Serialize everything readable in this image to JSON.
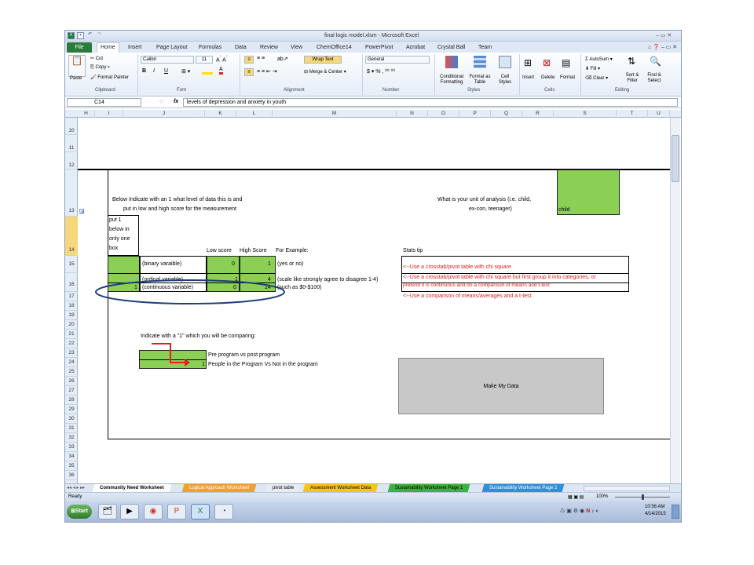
{
  "window": {
    "title": "final logic model.xlsm - Microsoft Excel"
  },
  "ribbon": {
    "file_tab": "File",
    "tabs": [
      "Home",
      "Insert",
      "Page Layout",
      "Formulas",
      "Data",
      "Review",
      "View",
      "ChemOffice14",
      "PowerPivot",
      "Acrobat",
      "Crystal Ball",
      "Team"
    ],
    "clipboard": {
      "paste": "Paste",
      "cut": "Cut",
      "copy": "Copy",
      "format_painter": "Format Painter",
      "label": "Clipboard"
    },
    "font": {
      "name": "Calibri",
      "size": "11",
      "label": "Font"
    },
    "alignment": {
      "wrap_text": "Wrap Text",
      "merge_center": "Merge & Center",
      "label": "Alignment"
    },
    "number": {
      "format": "General",
      "label": "Number"
    },
    "styles": {
      "conditional": "Conditional Formatting",
      "format_table": "Format as Table",
      "cell_styles": "Cell Styles",
      "label": "Styles"
    },
    "cells": {
      "insert": "Insert",
      "delete": "Delete",
      "format": "Format",
      "label": "Cells"
    },
    "editing": {
      "autosum": "AutoSum",
      "fill": "Fill",
      "clear": "Clear",
      "sort_filter": "Sort & Filter",
      "find_select": "Find & Select",
      "label": "Editing"
    }
  },
  "formula_bar": {
    "name_box": "C14",
    "fx": "fx",
    "content": "levels of depression and anxiety in youth"
  },
  "columns": [
    "H",
    "I",
    "J",
    "K",
    "L",
    "M",
    "N",
    "O",
    "P",
    "Q",
    "R",
    "S",
    "T",
    "U"
  ],
  "rows": [
    "10",
    "11",
    "12",
    "13",
    "14",
    "15",
    "16",
    "17",
    "18",
    "19",
    "20",
    "21",
    "22",
    "23",
    "24",
    "25",
    "26",
    "27",
    "28",
    "29",
    "30",
    "31",
    "32",
    "33",
    "34",
    "35",
    "36"
  ],
  "cells": {
    "h13": "rg",
    "instruction_line1": "Below Indicate with an 1 what level of data this is and",
    "instruction_line2": "put in low and high score for the measurement",
    "unit_question_line1": "What is your unit of analysis (i.e. child,",
    "unit_question_line2": "ex-con, teenager)",
    "unit_answer": "child",
    "put1_lines": [
      "put 1",
      "below in",
      "only one",
      "box"
    ],
    "low_score": "Low score",
    "high_score": "High Score",
    "for_example": "For Example:",
    "stats_tip": "Stats tip",
    "binary": "(binary varaible)",
    "binary_low": "0",
    "binary_high": "1",
    "binary_example": "(yes or no)",
    "ordinal": "(ordinal variable)",
    "ordinal_low": "1",
    "ordinal_high": "4",
    "ordinal_example": "(scale like strongly agree to disagree 1-4)",
    "continuous_flag": "1",
    "continuous": "(continuous variable)",
    "continuous_low": "0",
    "continuous_high": "24",
    "continuous_example": "(such as $0-$100)",
    "tip1": "<--Use a crosstab/pivot table with chi square",
    "tip2a": "<--Use a crosstab/pivot table with chi square but first group it into categories, or",
    "tip2b": "pretend it is continuous and do a comparison of means and t-test",
    "tip3": "<--Use a comparison of means/averages and a t-test",
    "compare_instruction": "Indicate with a \"1\" which you will be comparing:",
    "pre_post": "Pre program vs post program",
    "people_flag": "1",
    "people": "People in the Program Vs Not in the program",
    "make_data_button": "Make My Data"
  },
  "sheet_tabs": [
    {
      "label": "Community Need Worksheet",
      "color": "#ffffff",
      "active": true
    },
    {
      "label": "Logical Approach Worksheet",
      "color": "#f0a030"
    },
    {
      "label": "pivot table",
      "color": "#e8ecf2"
    },
    {
      "label": "Assessment Worksheet Data",
      "color": "#f5c518"
    },
    {
      "label": "Sustainability Worksheet Page 1",
      "color": "#3cb043"
    },
    {
      "label": "Sustainability Worksheet Page 2",
      "color": "#2f8fd8"
    }
  ],
  "status": {
    "ready": "Ready",
    "zoom": "100%"
  },
  "taskbar": {
    "start": "Start",
    "time": "10:56 AM",
    "date": "4/14/2015"
  },
  "colors": {
    "green_cell": "#8ccf55",
    "tip_red": "#e02020",
    "excel_green": "#2a7a3c"
  }
}
